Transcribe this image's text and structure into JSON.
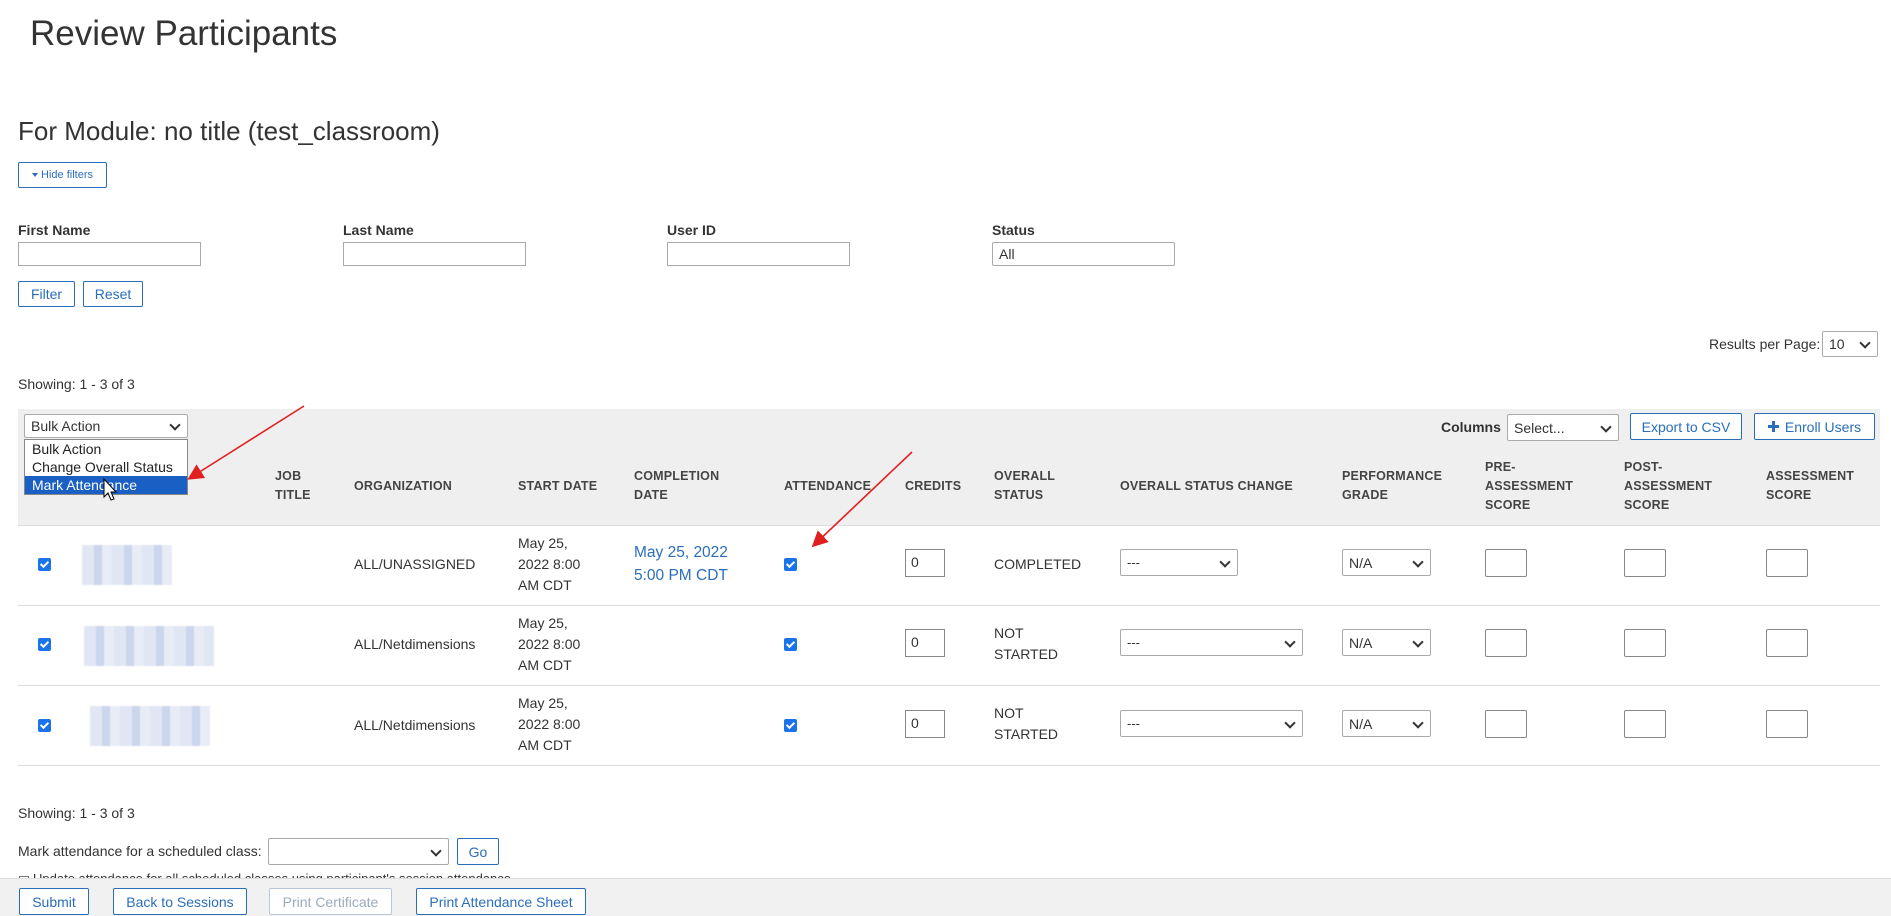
{
  "page": {
    "title": "Review Participants",
    "module_heading": "For Module: no title (test_classroom)"
  },
  "filters": {
    "toggle_label": "Hide filters",
    "first_name_label": "First Name",
    "last_name_label": "Last Name",
    "user_id_label": "User ID",
    "status_label": "Status",
    "status_value": "All",
    "filter_button": "Filter",
    "reset_button": "Reset"
  },
  "results": {
    "per_page_label": "Results per Page:",
    "per_page_value": "10",
    "showing_top": "Showing: 1 - 3 of 3",
    "showing_bottom": "Showing: 1 - 3 of 3"
  },
  "toolbar": {
    "bulk_action_value": "Bulk Action",
    "bulk_options": [
      "Bulk Action",
      "Change Overall Status",
      "Mark Attendance"
    ],
    "selected_option": "Mark Attendance",
    "columns_label": "Columns",
    "columns_value": "Select...",
    "export_button": "Export to CSV",
    "enroll_button": "Enroll Users"
  },
  "table": {
    "headers": {
      "job_title": [
        "JOB",
        "TITLE"
      ],
      "organization": "ORGANIZATION",
      "start_date": "START DATE",
      "completion_date": [
        "COMPLETION",
        "DATE"
      ],
      "attendance": "ATTENDANCE",
      "credits": "CREDITS",
      "overall_status": [
        "OVERALL",
        "STATUS"
      ],
      "overall_status_change": "OVERALL STATUS CHANGE",
      "performance_grade": [
        "PERFORMANCE",
        "GRADE"
      ],
      "pre_assessment": [
        "PRE-",
        "ASSESSMENT",
        "SCORE"
      ],
      "post_assessment": [
        "POST-",
        "ASSESSMENT",
        "SCORE"
      ],
      "assessment_score": [
        "ASSESSMENT",
        "SCORE"
      ]
    },
    "rows": [
      {
        "organization": "ALL/UNASSIGNED",
        "start_date": [
          "May 25,",
          "2022 8:00",
          "AM CDT"
        ],
        "completion_date": [
          "May 25, 2022",
          "5:00 PM CDT"
        ],
        "credits": "0",
        "overall_status": [
          "COMPLETED"
        ],
        "status_change": "---",
        "grade": "N/A"
      },
      {
        "organization": "ALL/Netdimensions",
        "start_date": [
          "May 25,",
          "2022 8:00",
          "AM CDT"
        ],
        "completion_date": [
          "",
          ""
        ],
        "credits": "0",
        "overall_status": [
          "NOT",
          "STARTED"
        ],
        "status_change": "---",
        "grade": "N/A"
      },
      {
        "organization": "ALL/Netdimensions",
        "start_date": [
          "May 25,",
          "2022 8:00",
          "AM CDT"
        ],
        "completion_date": [
          "",
          ""
        ],
        "credits": "0",
        "overall_status": [
          "NOT",
          "STARTED"
        ],
        "status_change": "---",
        "grade": "N/A"
      }
    ]
  },
  "footer": {
    "mark_attendance_label": "Mark attendance for a scheduled class:",
    "go_button": "Go",
    "update_attendance_label": "Update attendance for all scheduled classes using participant's session attendance",
    "submit_button": "Submit",
    "back_button": "Back to Sessions",
    "print_certificate_button": "Print Certificate",
    "print_attendance_button": "Print Attendance Sheet"
  },
  "colors": {
    "accent": "#2a6ebb",
    "selected": "#1a5fc4",
    "arrow": "#e02020",
    "band": "#efefef"
  }
}
